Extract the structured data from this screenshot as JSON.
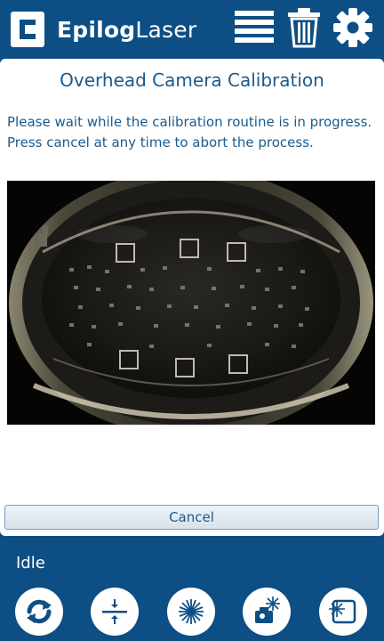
{
  "header": {
    "brand_bold": "Epilog",
    "brand_light": "Laser",
    "icons": [
      "job-list-icon",
      "trash-icon",
      "gear-icon"
    ]
  },
  "dialog": {
    "title": "Overhead Camera Calibration",
    "message": "Please wait while the calibration routine is in progress. Press cancel at any time to abort the process.",
    "cancel_label": "Cancel"
  },
  "status": {
    "text": "Idle"
  },
  "toolbar": {
    "buttons": [
      "refresh-icon",
      "focus-icon",
      "laser-icon",
      "job-laser-icon",
      "frame-laser-icon"
    ]
  },
  "colors": {
    "brand_blue": "#0d4f84",
    "text_blue": "#1a5b8e",
    "panel": "#ffffff"
  }
}
